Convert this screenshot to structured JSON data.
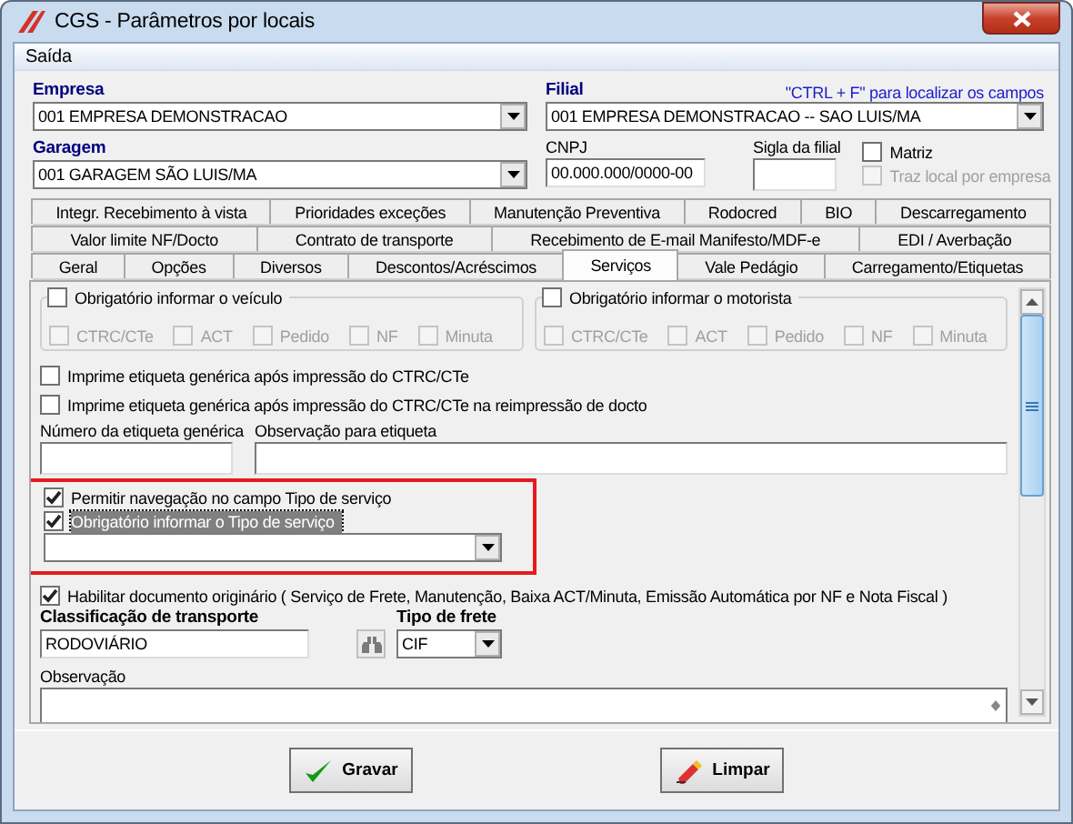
{
  "window": {
    "title": "CGS - Parâmetros por locais"
  },
  "menu": [
    {
      "label": "Saída"
    }
  ],
  "header": {
    "empresa": {
      "label": "Empresa",
      "value": "001 EMPRESA DEMONSTRACAO"
    },
    "filial": {
      "label": "Filial",
      "value": "001 EMPRESA DEMONSTRACAO -- SAO LUIS/MA"
    },
    "hint": "\"CTRL + F\" para localizar os campos",
    "garagem": {
      "label": "Garagem",
      "value": "001 GARAGEM SÃO LUIS/MA"
    },
    "cnpj": {
      "label": "CNPJ",
      "value": "00.000.000/0000-00"
    },
    "sigla": {
      "label": "Sigla da filial"
    },
    "checkboxes": [
      {
        "label": "Matriz",
        "checked": false,
        "disabled": false
      },
      {
        "label": "Traz local por empresa",
        "checked": false,
        "disabled": true
      }
    ]
  },
  "tab_rows": [
    [
      {
        "label": "Integr. Recebimento à vista",
        "selected": false
      },
      {
        "label": "Prioridades exceções",
        "selected": false
      },
      {
        "label": "Manutenção Preventiva",
        "selected": false
      },
      {
        "label": "Rodocred",
        "selected": false
      },
      {
        "label": "BIO",
        "selected": false
      },
      {
        "label": "Descarregamento",
        "selected": false
      }
    ],
    [
      {
        "label": "Valor limite NF/Docto",
        "selected": false
      },
      {
        "label": "Contrato de transporte",
        "selected": false
      },
      {
        "label": "Recebimento de E-mail Manifesto/MDF-e",
        "selected": false
      },
      {
        "label": "EDI / Averbação",
        "selected": false
      }
    ],
    [
      {
        "label": "Geral",
        "selected": false
      },
      {
        "label": "Opções",
        "selected": false
      },
      {
        "label": "Diversos",
        "selected": false
      },
      {
        "label": "Descontos/Acréscimos",
        "selected": false
      },
      {
        "label": "Serviços",
        "selected": true
      },
      {
        "label": "Vale Pedágio",
        "selected": false
      },
      {
        "label": "Carregamento/Etiquetas",
        "selected": false
      }
    ]
  ],
  "content": {
    "groups": [
      {
        "label": "Obrigatório informar o veículo",
        "checked": false,
        "options": [
          {
            "label": "CTRC/CTe",
            "checked": false,
            "disabled": true
          },
          {
            "label": "ACT",
            "checked": false,
            "disabled": true
          },
          {
            "label": "Pedido",
            "checked": false,
            "disabled": true
          },
          {
            "label": "NF",
            "checked": false,
            "disabled": true
          },
          {
            "label": "Minuta",
            "checked": false,
            "disabled": true
          }
        ]
      },
      {
        "label": "Obrigatório informar o motorista",
        "checked": false,
        "options": [
          {
            "label": "CTRC/CTe",
            "checked": false,
            "disabled": true
          },
          {
            "label": "ACT",
            "checked": false,
            "disabled": true
          },
          {
            "label": "Pedido",
            "checked": false,
            "disabled": true
          },
          {
            "label": "NF",
            "checked": false,
            "disabled": true
          },
          {
            "label": "Minuta",
            "checked": false,
            "disabled": true
          }
        ]
      }
    ],
    "print_options": [
      {
        "label": "Imprime etiqueta genérica após impressão do CTRC/CTe",
        "checked": false
      },
      {
        "label": "Imprime etiqueta genérica após impressão do CTRC/CTe na reimpressão de docto",
        "checked": false
      }
    ],
    "label_fields": [
      {
        "label": "Número da etiqueta genérica"
      },
      {
        "label": "Observação para etiqueta"
      }
    ],
    "service_options": [
      {
        "label": "Permitir navegação no campo Tipo de serviço",
        "checked": true,
        "focused": false
      },
      {
        "label": "Obrigatório informar o Tipo de serviço",
        "checked": true,
        "focused": true
      }
    ],
    "habilitar": {
      "label": "Habilitar documento originário ( Serviço de Frete, Manutenção, Baixa ACT/Minuta, Emissão Automática por NF e Nota Fiscal )",
      "checked": true
    },
    "classificacao": {
      "label": "Classificação de transporte",
      "value": "RODOVIÁRIO"
    },
    "tipo_frete": {
      "label": "Tipo de frete",
      "value": "CIF"
    },
    "observacao": {
      "label": "Observação"
    }
  },
  "buttons": [
    {
      "label": "Gravar",
      "kind": "save"
    },
    {
      "label": "Limpar",
      "kind": "clear"
    }
  ]
}
